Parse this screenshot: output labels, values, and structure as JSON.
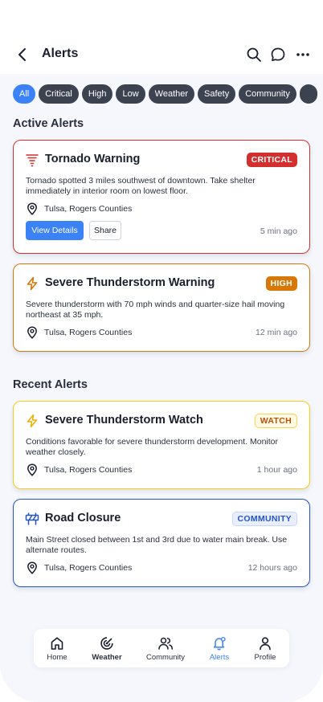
{
  "header": {
    "title": "Alerts"
  },
  "filters": [
    "All",
    "Critical",
    "High",
    "Low",
    "Weather",
    "Safety",
    "Community"
  ],
  "sections": {
    "active": "Active Alerts",
    "recent": "Recent Alerts"
  },
  "alerts": [
    {
      "title": "Tornado Warning",
      "badge": "CRITICAL",
      "description": "Tornado spotted 3 miles southwest of downtown. Take shelter immediately in interior room on lowest floor.",
      "location": "Tulsa, Rogers Counties",
      "time": "5 min ago",
      "actions": {
        "primary": "View Details",
        "secondary": "Share"
      },
      "icon": "tornado-icon",
      "color": "#d32f2f"
    },
    {
      "title": "Severe Thunderstorm Warning",
      "badge": "HIGH",
      "description": "Severe thunderstorm with 70 mph winds and quarter-size hail moving northeast at 35 mph.",
      "location": "Tulsa, Rogers Counties",
      "time": "12 min ago",
      "icon": "lightning-icon",
      "color": "#d97706"
    },
    {
      "title": "Severe Thunderstorm Watch",
      "badge": "WATCH",
      "description": "Conditions favorable for severe thunderstorm development. Monitor weather closely.",
      "location": "Tulsa, Rogers Counties",
      "time": "1 hour ago",
      "icon": "lightning-icon",
      "color": "#eab308"
    },
    {
      "title": "Road Closure",
      "badge": "COMMUNITY",
      "description": "Main Street closed between 1st and 3rd due to water main break. Use alternate routes.",
      "location": "Tulsa, Rogers Counties",
      "time": "12 hours ago",
      "icon": "road-barrier-icon",
      "color": "#2454c6"
    }
  ],
  "nav": [
    {
      "label": "Home",
      "icon": "home-icon"
    },
    {
      "label": "Weather",
      "icon": "radar-icon"
    },
    {
      "label": "Community",
      "icon": "users-icon"
    },
    {
      "label": "Alerts",
      "icon": "bell-icon",
      "active": true
    },
    {
      "label": "Profile",
      "icon": "user-icon"
    }
  ]
}
